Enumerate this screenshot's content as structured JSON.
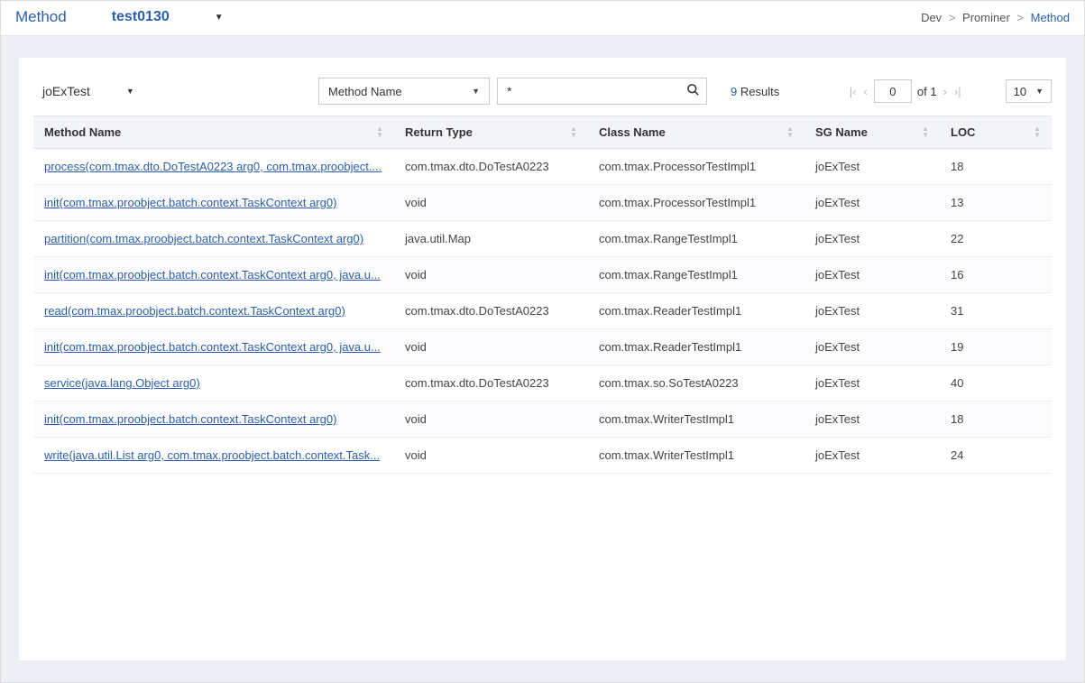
{
  "header": {
    "title": "Method",
    "project": "test0130"
  },
  "breadcrumb": {
    "dev": "Dev",
    "prominer": "Prominer",
    "method": "Method"
  },
  "toolbar": {
    "sg_filter": "joExTest",
    "search_field": "Method  Name",
    "search_value": "*",
    "results_count": "9",
    "results_label": "Results",
    "page_current": "0",
    "page_of_label": "of",
    "page_total": "1",
    "page_size": "10"
  },
  "columns": {
    "method": "Method  Name",
    "return": "Return  Type",
    "class": "Class  Name",
    "sg": "SG  Name",
    "loc": "LOC"
  },
  "rows": [
    {
      "method": "process(com.tmax.dto.DoTestA0223 arg0,  com.tmax.proobject....",
      "return": "com.tmax.dto.DoTestA0223",
      "class": "com.tmax.ProcessorTestImpl1",
      "sg": "joExTest",
      "loc": "18"
    },
    {
      "method": "init(com.tmax.proobject.batch.context.TaskContext arg0)",
      "return": "void",
      "class": "com.tmax.ProcessorTestImpl1",
      "sg": "joExTest",
      "loc": "13"
    },
    {
      "method": "partition(com.tmax.proobject.batch.context.TaskContext arg0)",
      "return": "java.util.Map",
      "class": "com.tmax.RangeTestImpl1",
      "sg": "joExTest",
      "loc": "22"
    },
    {
      "method": "init(com.tmax.proobject.batch.context.TaskContext arg0,  java.u...",
      "return": "void",
      "class": "com.tmax.RangeTestImpl1",
      "sg": "joExTest",
      "loc": "16"
    },
    {
      "method": "read(com.tmax.proobject.batch.context.TaskContext arg0)",
      "return": "com.tmax.dto.DoTestA0223",
      "class": "com.tmax.ReaderTestImpl1",
      "sg": "joExTest",
      "loc": "31"
    },
    {
      "method": "init(com.tmax.proobject.batch.context.TaskContext arg0,  java.u...",
      "return": "void",
      "class": "com.tmax.ReaderTestImpl1",
      "sg": "joExTest",
      "loc": "19"
    },
    {
      "method": "service(java.lang.Object arg0)",
      "return": "com.tmax.dto.DoTestA0223",
      "class": "com.tmax.so.SoTestA0223",
      "sg": "joExTest",
      "loc": "40"
    },
    {
      "method": "init(com.tmax.proobject.batch.context.TaskContext arg0)",
      "return": "void",
      "class": "com.tmax.WriterTestImpl1",
      "sg": "joExTest",
      "loc": "18"
    },
    {
      "method": "write(java.util.List arg0,  com.tmax.proobject.batch.context.Task...",
      "return": "void",
      "class": "com.tmax.WriterTestImpl1",
      "sg": "joExTest",
      "loc": "24"
    }
  ]
}
